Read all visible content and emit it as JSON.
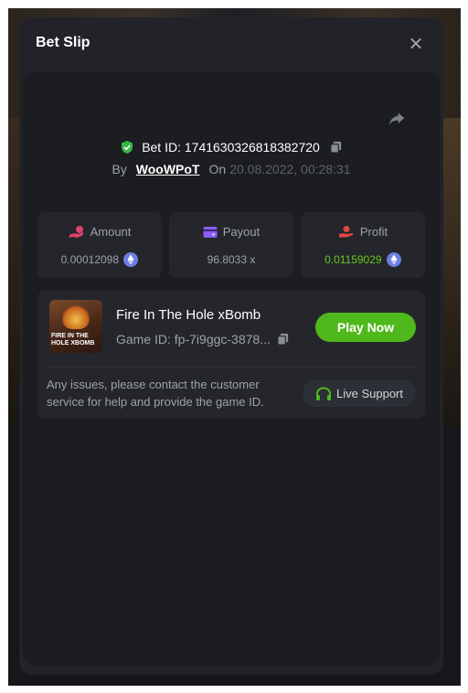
{
  "modal": {
    "title": "Bet Slip"
  },
  "bet": {
    "id_label": "Bet ID:",
    "id_value": "1741630326818382720",
    "by_label": "By",
    "username": "WooWPoT",
    "on_label": "On",
    "datetime": "20.08.2022, 00:28:31"
  },
  "stats": {
    "amount": {
      "label": "Amount",
      "value": "0.00012098",
      "currency_icon": "eth-icon"
    },
    "payout": {
      "label": "Payout",
      "value": "96.8033 x"
    },
    "profit": {
      "label": "Profit",
      "value": "0.01159029",
      "currency_icon": "eth-icon"
    }
  },
  "game": {
    "thumb_text_line1": "FIRE IN THE",
    "thumb_text_line2": "HOLE XBOMB",
    "title": "Fire In The Hole xBomb",
    "id_label": "Game ID:",
    "id_value": "fp-7i9ggc-3878...",
    "play_label": "Play Now",
    "help_text": "Any issues, please contact the customer service for help and provide the game ID.",
    "support_label": "Live Support"
  },
  "colors": {
    "accent_green": "#4fb81c",
    "profit_green": "#6bc51a",
    "amount_pink": "#e0426b",
    "payout_purple": "#8b5cf6",
    "profit_red": "#e04646",
    "eth_blue": "#6b7fe3"
  }
}
